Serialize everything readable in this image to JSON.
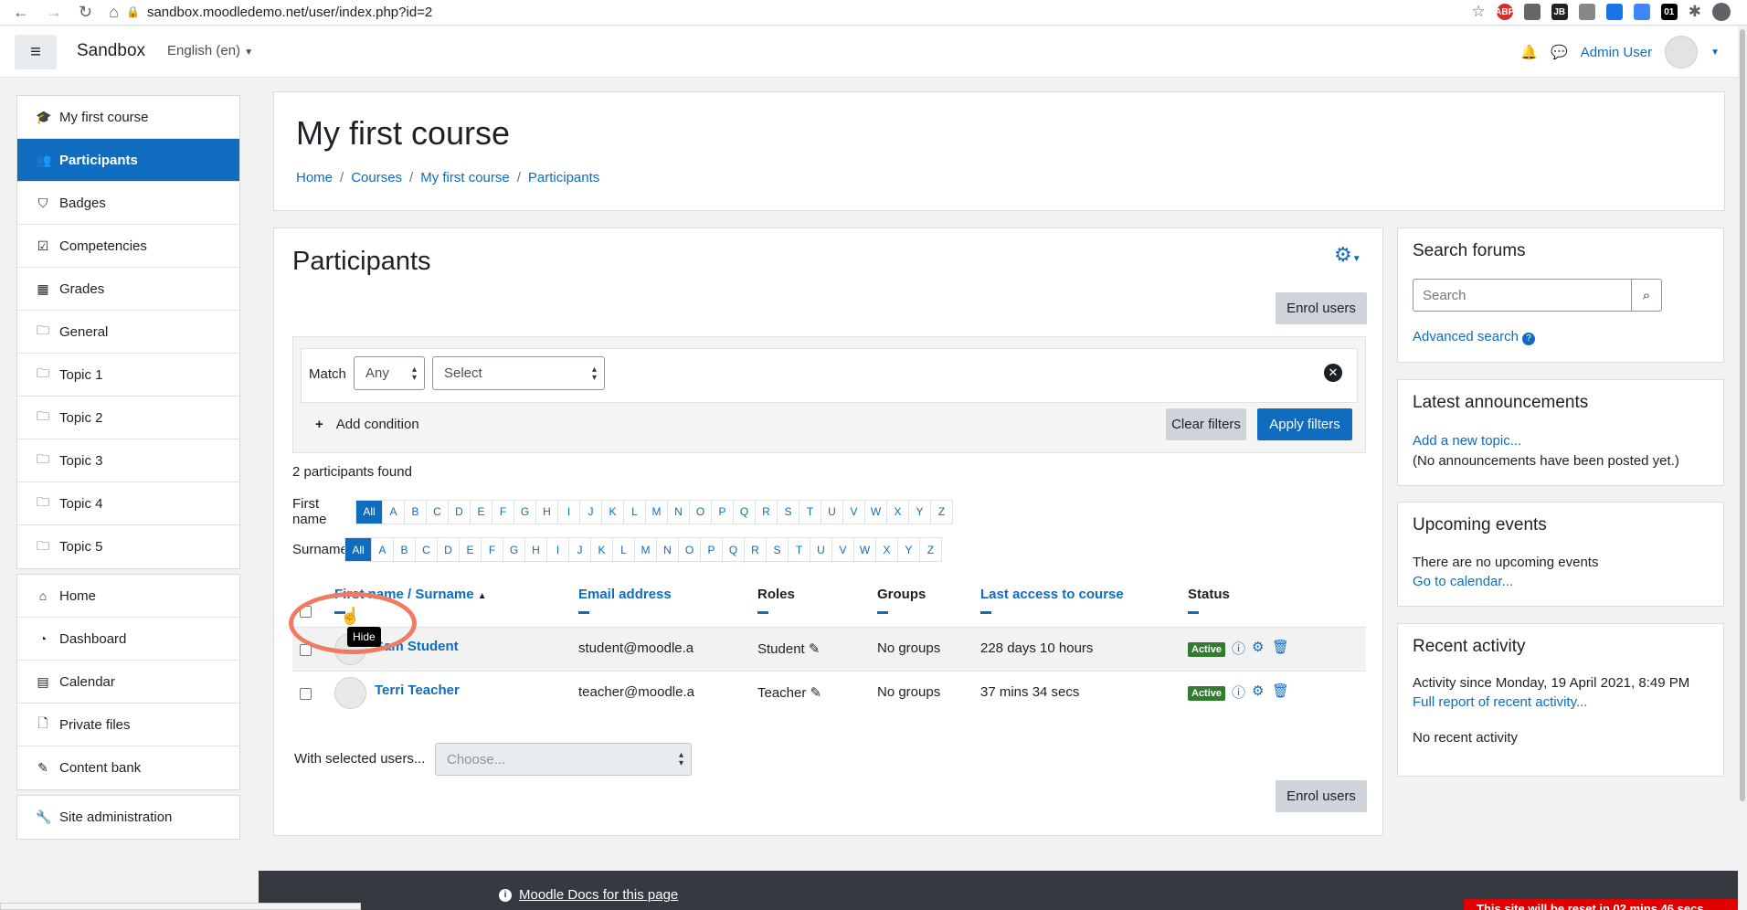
{
  "browser": {
    "url": "sandbox.moodledemo.net/user/index.php?id=2"
  },
  "navbar": {
    "brand": "Sandbox",
    "language": "English (en)",
    "user_name": "Admin User"
  },
  "drawer": {
    "course_items": [
      {
        "label": "My first course",
        "icon": "graduation-cap-icon",
        "glyph": "🎓"
      },
      {
        "label": "Participants",
        "icon": "users-icon",
        "glyph": "👥",
        "active": true
      },
      {
        "label": "Badges",
        "icon": "shield-icon",
        "glyph": "⛉"
      },
      {
        "label": "Competencies",
        "icon": "check-square-icon",
        "glyph": "☑"
      },
      {
        "label": "Grades",
        "icon": "table-icon",
        "glyph": "▦"
      },
      {
        "label": "General",
        "icon": "folder-icon",
        "glyph": "🗀"
      },
      {
        "label": "Topic 1",
        "icon": "folder-icon",
        "glyph": "🗀"
      },
      {
        "label": "Topic 2",
        "icon": "folder-icon",
        "glyph": "🗀"
      },
      {
        "label": "Topic 3",
        "icon": "folder-icon",
        "glyph": "🗀"
      },
      {
        "label": "Topic 4",
        "icon": "folder-icon",
        "glyph": "🗀"
      },
      {
        "label": "Topic 5",
        "icon": "folder-icon",
        "glyph": "🗀"
      }
    ],
    "site_items": [
      {
        "label": "Home",
        "icon": "home-icon",
        "glyph": "⌂"
      },
      {
        "label": "Dashboard",
        "icon": "dashboard-icon",
        "glyph": "◔"
      },
      {
        "label": "Calendar",
        "icon": "calendar-icon",
        "glyph": "▤"
      },
      {
        "label": "Private files",
        "icon": "file-icon",
        "glyph": "🗋"
      },
      {
        "label": "Content bank",
        "icon": "brush-icon",
        "glyph": "✎"
      }
    ],
    "admin_items": [
      {
        "label": "Site administration",
        "icon": "wrench-icon",
        "glyph": "🔧"
      }
    ]
  },
  "header": {
    "title": "My first course",
    "breadcrumbs": [
      "Home",
      "Courses",
      "My first course",
      "Participants"
    ]
  },
  "participants": {
    "title": "Participants",
    "enrol_label": "Enrol users",
    "filter": {
      "match_label": "Match",
      "match_value": "Any",
      "select_value": "Select",
      "add_condition": "Add condition",
      "clear_label": "Clear filters",
      "apply_label": "Apply filters"
    },
    "found_text": "2 participants found",
    "firstname_label": "First name",
    "surname_label": "Surname",
    "all_label": "All",
    "letters": [
      "A",
      "B",
      "C",
      "D",
      "E",
      "F",
      "G",
      "H",
      "I",
      "J",
      "K",
      "L",
      "M",
      "N",
      "O",
      "P",
      "Q",
      "R",
      "S",
      "T",
      "U",
      "V",
      "W",
      "X",
      "Y",
      "Z"
    ],
    "columns": {
      "name": "First name / Surname",
      "email": "Email address",
      "roles": "Roles",
      "groups": "Groups",
      "last_access": "Last access to course",
      "status": "Status"
    },
    "rows": [
      {
        "name": "Sam Student",
        "email": "student@moodle.a",
        "role": "Student",
        "groups": "No groups",
        "last_access": "228 days 10 hours",
        "status": "Active"
      },
      {
        "name": "Terri Teacher",
        "email": "teacher@moodle.a",
        "role": "Teacher",
        "groups": "No groups",
        "last_access": "37 mins 34 secs",
        "status": "Active"
      }
    ],
    "with_selected_label": "With selected users...",
    "with_selected_placeholder": "Choose...",
    "tooltip": "Hide"
  },
  "blocks": {
    "search": {
      "title": "Search forums",
      "placeholder": "Search",
      "advanced": "Advanced search"
    },
    "announcements": {
      "title": "Latest announcements",
      "link": "Add a new topic...",
      "text": "(No announcements have been posted yet.)"
    },
    "events": {
      "title": "Upcoming events",
      "text": "There are no upcoming events",
      "link": "Go to calendar..."
    },
    "activity": {
      "title": "Recent activity",
      "since": "Activity since Monday, 19 April 2021, 8:49 PM",
      "link": "Full report of recent activity...",
      "text": "No recent activity"
    }
  },
  "footer": {
    "docs_link": "Moodle Docs for this page",
    "reset_banner": "This site will be reset in 02 mins 46 secs"
  },
  "colors": {
    "brand_blue": "#0f6cbf",
    "active_green": "#357a32",
    "highlight_ring": "#f07b62"
  }
}
